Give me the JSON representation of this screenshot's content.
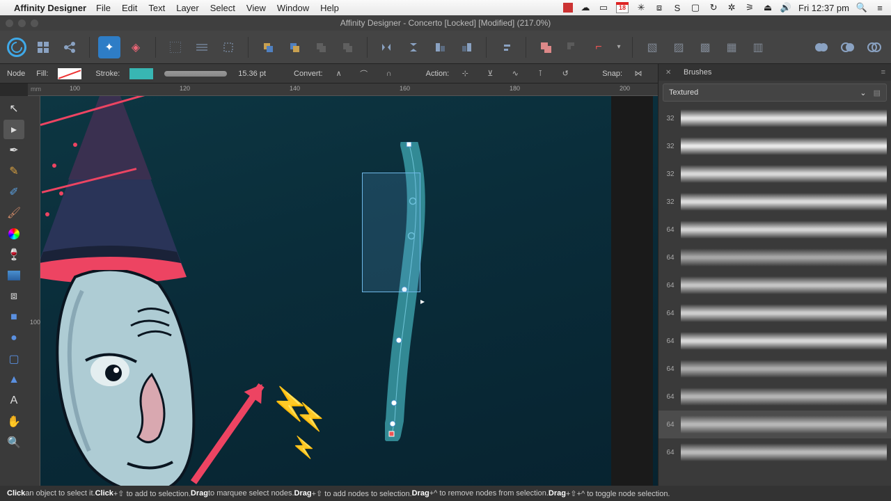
{
  "menubar": {
    "appname": "Affinity Designer",
    "items": [
      "File",
      "Edit",
      "Text",
      "Layer",
      "Select",
      "View",
      "Window",
      "Help"
    ],
    "calendar": "18",
    "clock": "Fri 12:37 pm"
  },
  "titlebar": {
    "label": "Affinity Designer - Concerto [Locked] [Modified] (217.0%)"
  },
  "contextbar": {
    "tool": "Node",
    "fill_label": "Fill:",
    "stroke_label": "Stroke:",
    "stroke_color": "#38b6b3",
    "stroke_width": "15.36 pt",
    "convert_label": "Convert:",
    "action_label": "Action:",
    "snap_label": "Snap:"
  },
  "ruler": {
    "unit": "mm",
    "h": [
      "100",
      "120",
      "140",
      "160",
      "180",
      "200"
    ],
    "v": [
      "100"
    ]
  },
  "brushes": {
    "title": "Brushes",
    "category": "Textured",
    "rows": [
      {
        "size": "32",
        "op": 0.85
      },
      {
        "size": "32",
        "op": 0.88
      },
      {
        "size": "32",
        "op": 0.8
      },
      {
        "size": "32",
        "op": 0.82
      },
      {
        "size": "64",
        "op": 0.78
      },
      {
        "size": "64",
        "op": 0.55
      },
      {
        "size": "64",
        "op": 0.7
      },
      {
        "size": "64",
        "op": 0.75
      },
      {
        "size": "64",
        "op": 0.8
      },
      {
        "size": "64",
        "op": 0.58
      },
      {
        "size": "64",
        "op": 0.62
      },
      {
        "size": "64",
        "op": 0.6,
        "sel": true
      },
      {
        "size": "64",
        "op": 0.65
      }
    ]
  },
  "statusbar": {
    "t1": "Click",
    "t2": " an object to select it. ",
    "t3": "Click",
    "t4": "+⇧ to add to selection. ",
    "t5": "Drag",
    "t6": " to marquee select nodes. ",
    "t7": "Drag",
    "t8": "+⇧ to add nodes to selection. ",
    "t9": "Drag",
    "t10": "+^ to remove nodes from selection. ",
    "t11": "Drag",
    "t12": "+⇧+^ to toggle node selection."
  }
}
